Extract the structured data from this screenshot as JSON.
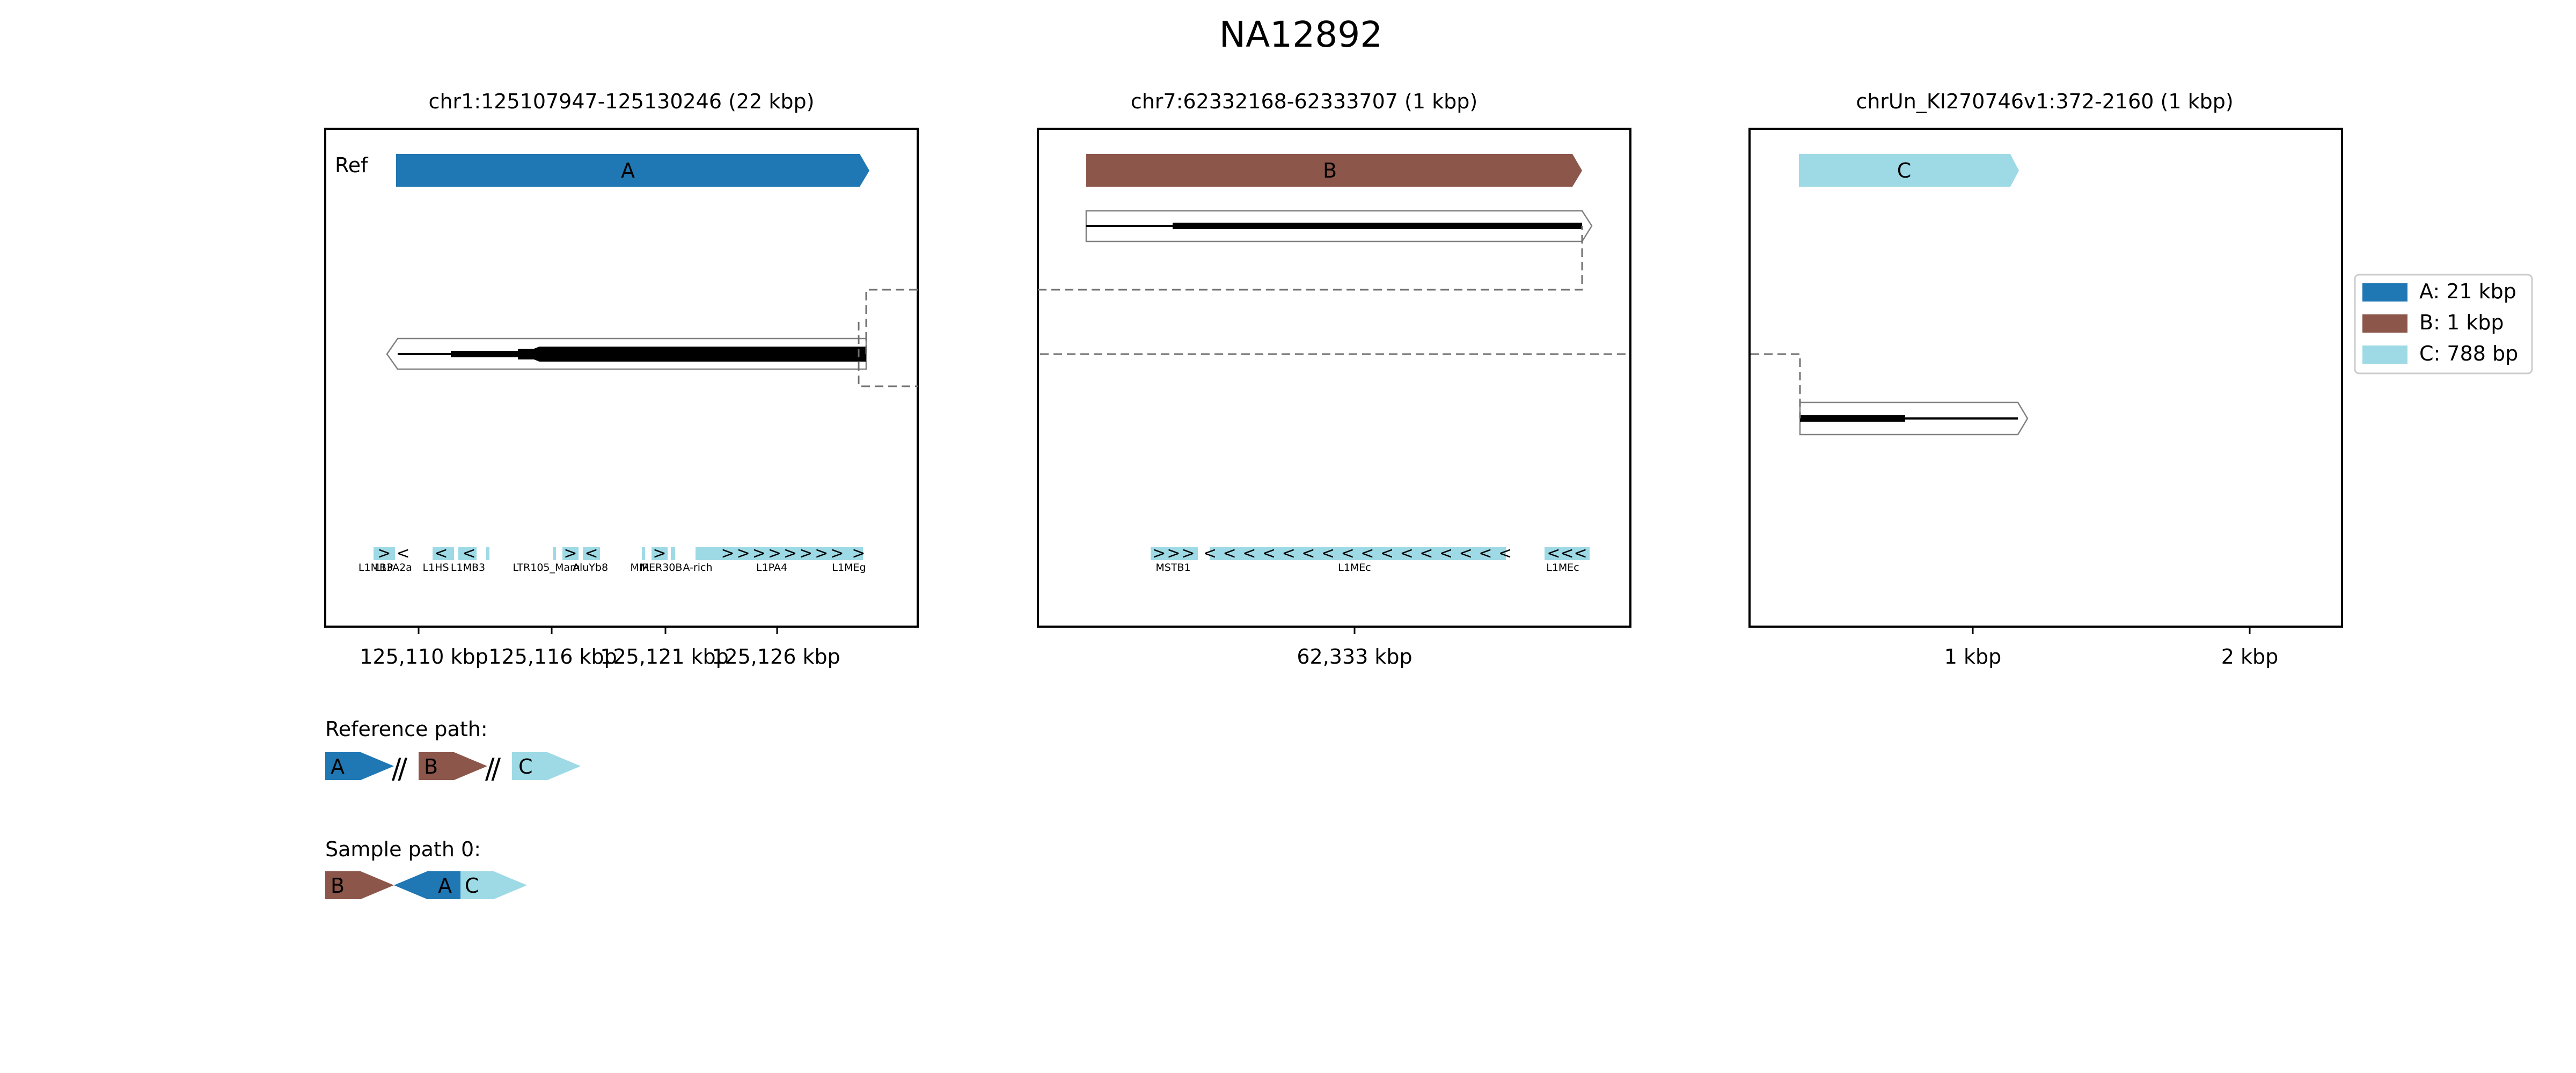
{
  "title": "NA12892",
  "colors": {
    "A": "#1f77b4",
    "B": "#8c564b",
    "C": "#9edae5",
    "read": "#000000",
    "outline": "#808080",
    "repeat": "#9edae5"
  },
  "panels": [
    {
      "id": "p1",
      "header": "chr1:125107947-125130246 (22 kbp)",
      "ref_label": "Ref",
      "ref_segment": {
        "label": "A",
        "color": "A"
      },
      "ticks": [
        "125,110 kbp",
        "125,116 kbp",
        "125,121 kbp",
        "125,126 kbp"
      ],
      "repeats": [
        {
          "name": "L1MB3",
          "strand": ">"
        },
        {
          "name": "L1PA2a",
          "strand": "<"
        },
        {
          "name": "L1HS",
          "strand": "<"
        },
        {
          "name": "L1MB3",
          "strand": "<"
        },
        {
          "name": "LTR105_Mam",
          "strand": ""
        },
        {
          "name": "AluYb8",
          "strand": ">"
        },
        {
          "name": "",
          "strand": "<"
        },
        {
          "name": "MIR",
          "strand": ""
        },
        {
          "name": "MER30B",
          "strand": ">"
        },
        {
          "name": "A-rich",
          "strand": ""
        },
        {
          "name": "L1PA4",
          "strand": ">>>>>>>>"
        },
        {
          "name": "L1MEg",
          "strand": ">"
        }
      ]
    },
    {
      "id": "p2",
      "header": "chr7:62332168-62333707 (1 kbp)",
      "ref_segment": {
        "label": "B",
        "color": "B"
      },
      "ticks": [
        "62,333 kbp"
      ],
      "repeats": [
        {
          "name": "MSTB1",
          "strand": ">>>"
        },
        {
          "name": "L1MEc",
          "strand": "< < < < < < < < < < < < < < < <"
        },
        {
          "name": "L1MEc",
          "strand": "<<<"
        }
      ]
    },
    {
      "id": "p3",
      "header": "chrUn_KI270746v1:372-2160 (1 kbp)",
      "ref_segment": {
        "label": "C",
        "color": "C"
      },
      "ticks": [
        "1 kbp",
        "2 kbp"
      ],
      "repeats": []
    }
  ],
  "legend": [
    {
      "label": "A: 21 kbp",
      "color": "A"
    },
    {
      "label": "B: 1 kbp",
      "color": "B"
    },
    {
      "label": "C: 788 bp",
      "color": "C"
    }
  ],
  "reference_path": {
    "title": "Reference path:",
    "segments": [
      {
        "label": "A",
        "color": "A",
        "dir": ">"
      },
      {
        "label": "B",
        "color": "B",
        "dir": ">"
      },
      {
        "label": "C",
        "color": "C",
        "dir": ">"
      }
    ],
    "separator": "//"
  },
  "sample_path": {
    "title": "Sample path 0:",
    "segments": [
      {
        "label": "B",
        "color": "B",
        "dir": ">"
      },
      {
        "label": "A",
        "color": "A",
        "dir": "<"
      },
      {
        "label": "C",
        "color": "C",
        "dir": ">"
      }
    ]
  }
}
